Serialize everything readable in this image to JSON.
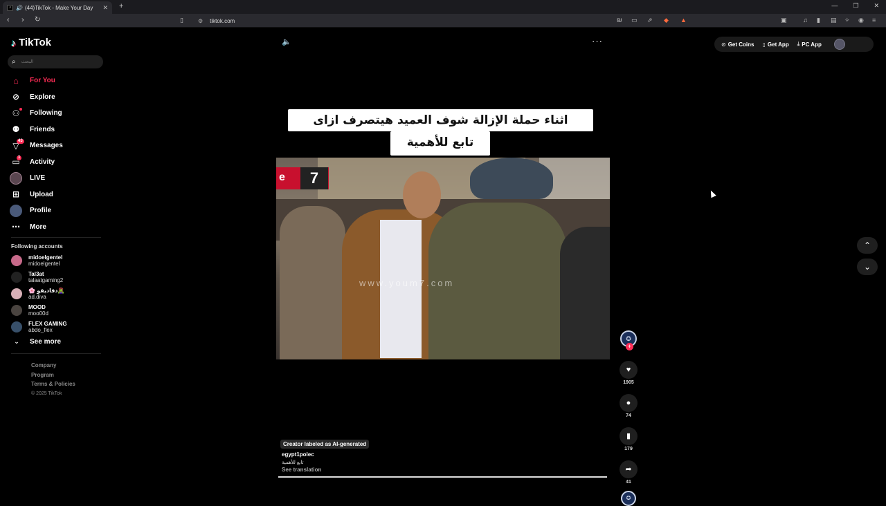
{
  "browser": {
    "tab_title": "(44)TikTok - Make Your Day",
    "url": "tiktok.com",
    "favicon": "tiktok-favicon"
  },
  "sidebar": {
    "logo": "TikTok",
    "search_placeholder": "البحث",
    "items": [
      {
        "label": "For You",
        "icon": "home-icon",
        "active": true
      },
      {
        "label": "Explore",
        "icon": "compass-icon"
      },
      {
        "label": "Following",
        "icon": "user-follow-icon"
      },
      {
        "label": "Friends",
        "icon": "friends-icon"
      },
      {
        "label": "Messages",
        "icon": "message-icon",
        "badge": "43"
      },
      {
        "label": "Activity",
        "icon": "activity-icon",
        "badge": "1"
      },
      {
        "label": "LIVE",
        "icon": "live-icon"
      },
      {
        "label": "Upload",
        "icon": "upload-icon"
      },
      {
        "label": "Profile",
        "icon": "profile-avatar"
      },
      {
        "label": "More",
        "icon": "more-icon"
      }
    ],
    "following_title": "Following accounts",
    "accounts": [
      {
        "name": "midoelgentel",
        "user": "midoelgentel"
      },
      {
        "name": "Tal3at",
        "user": "talaatgaming2"
      },
      {
        "name": "🌸 دقاديقو🧟‍♀️",
        "user": "ad.diva"
      },
      {
        "name": "MOOD",
        "user": "moo00d"
      },
      {
        "name": "FLEX GAMING",
        "user": "abdo_flex"
      }
    ],
    "see_more": "See more",
    "footer": [
      "Company",
      "Program",
      "Terms & Policies"
    ],
    "copyright": "© 2025 TikTok"
  },
  "topbar": {
    "get_coins": "Get Coins",
    "get_app": "Get App",
    "pc_app": "PC App"
  },
  "video": {
    "caption_line1": "اثناء حملة الإزالة شوف العميد هيتصرف ازاى",
    "caption_line2": "تابع للأهمية",
    "watermark": "www.youm7.com",
    "logo_number": "7",
    "ai_label": "Creator labeled as AI-generated",
    "author": "egypt1polec",
    "description": "تابع للأهمية",
    "see_translation": "See translation",
    "progress": 1.0
  },
  "actions": {
    "likes": "1905",
    "comments": "74",
    "saves": "179",
    "shares": "41"
  },
  "colors": {
    "accent": "#fe2c55",
    "background": "#000000"
  }
}
